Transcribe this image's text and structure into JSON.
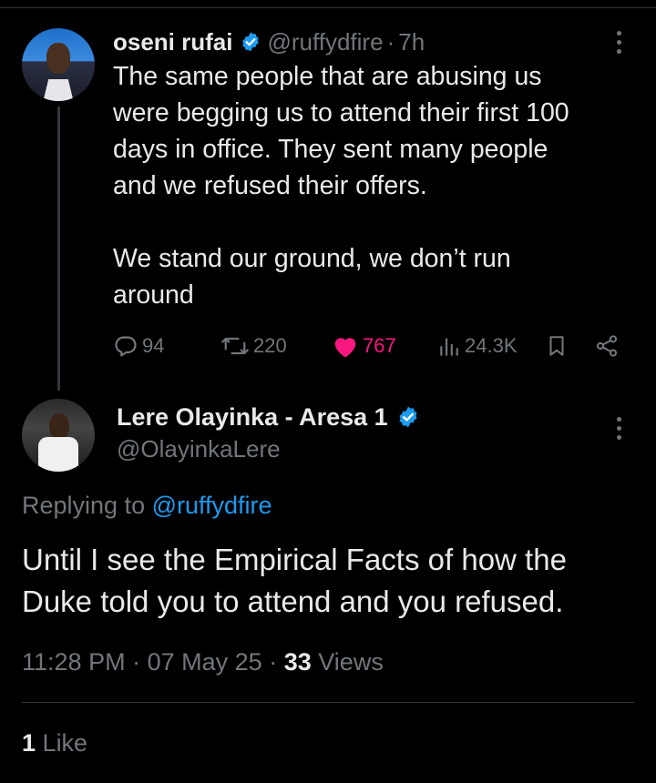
{
  "parent": {
    "name": "oseni rufai",
    "handle": "@ruffydfire",
    "separator": "·",
    "time": "7h",
    "text_lines": [
      "The same people that are abusing us",
      "were begging us to attend their first 100",
      "days in office. They sent many people",
      "and we refused their offers."
    ],
    "text_lines2": [
      "We stand our ground, we don’t run",
      "around"
    ],
    "stats": {
      "replies": "94",
      "reposts": "220",
      "likes": "767",
      "views": "24.3K"
    }
  },
  "reply": {
    "name": "Lere Olayinka - Aresa 1",
    "handle": "@OlayinkaLere",
    "replying_prefix": "Replying to",
    "replying_to": "@ruffydfire",
    "text_lines": [
      "Until I see the Empirical Facts of how the",
      "Duke told you to attend and you refused."
    ],
    "time": "11:28 PM",
    "date": "07 May 25",
    "dot": "·",
    "views_count": "33",
    "views_label": "Views",
    "like_count": "1",
    "like_label": "Like"
  },
  "colors": {
    "background": "#000000",
    "text": "#e7e9ea",
    "muted": "#71767b",
    "link": "#1d9bf0",
    "like": "#f91880",
    "divider": "#2f3336"
  },
  "icons": [
    "verified-badge-icon",
    "more-options-icon",
    "reply-icon",
    "repost-icon",
    "like-icon",
    "views-icon",
    "bookmark-icon",
    "share-icon"
  ]
}
